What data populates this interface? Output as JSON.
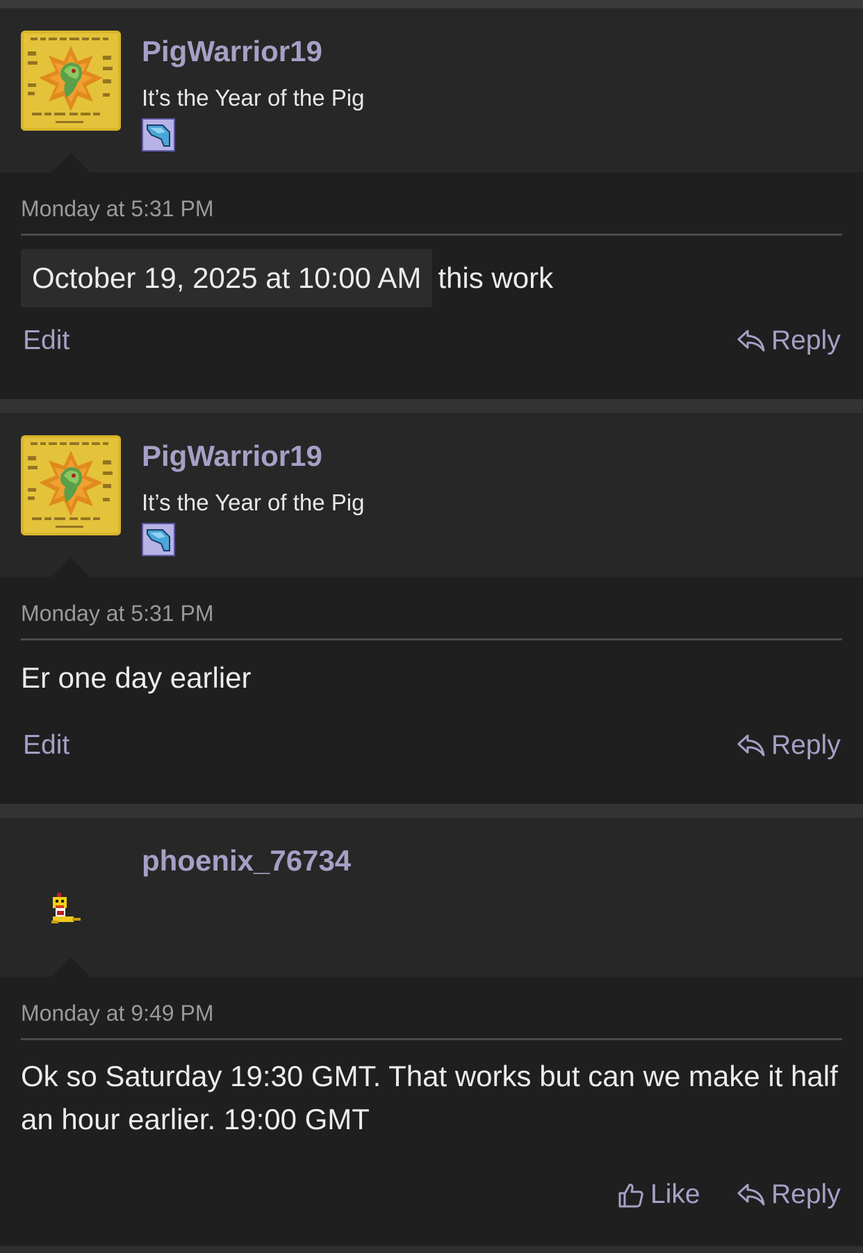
{
  "posts": [
    {
      "username": "PigWarrior19",
      "user_title": "It’s the Year of the Pig",
      "avatar_icon": "card-avatar-icon",
      "badge_icon": "pixel-badge-icon",
      "timestamp": "Monday at 5:31 PM",
      "date_chip": "October 19, 2025 at 10:00 AM",
      "text": "this work",
      "actions": {
        "edit": "Edit",
        "reply": "Reply"
      }
    },
    {
      "username": "PigWarrior19",
      "user_title": "It’s the Year of the Pig",
      "avatar_icon": "card-avatar-icon",
      "badge_icon": "pixel-badge-icon",
      "timestamp": "Monday at 5:31 PM",
      "text": "Er one day earlier",
      "actions": {
        "edit": "Edit",
        "reply": "Reply"
      }
    },
    {
      "username": "phoenix_76734",
      "avatar_icon": "pixel-character-avatar-icon",
      "timestamp": "Monday at 9:49 PM",
      "text": "Ok so Saturday 19:30 GMT. That works but can we make it half an hour earlier. 19:00 GMT",
      "actions": {
        "like": "Like",
        "reply": "Reply"
      }
    }
  ],
  "colors": {
    "accent": "#a6a0c6",
    "header_bg": "#272727",
    "body_bg": "#1f1f1f",
    "page_bg": "#2f2f2f"
  }
}
